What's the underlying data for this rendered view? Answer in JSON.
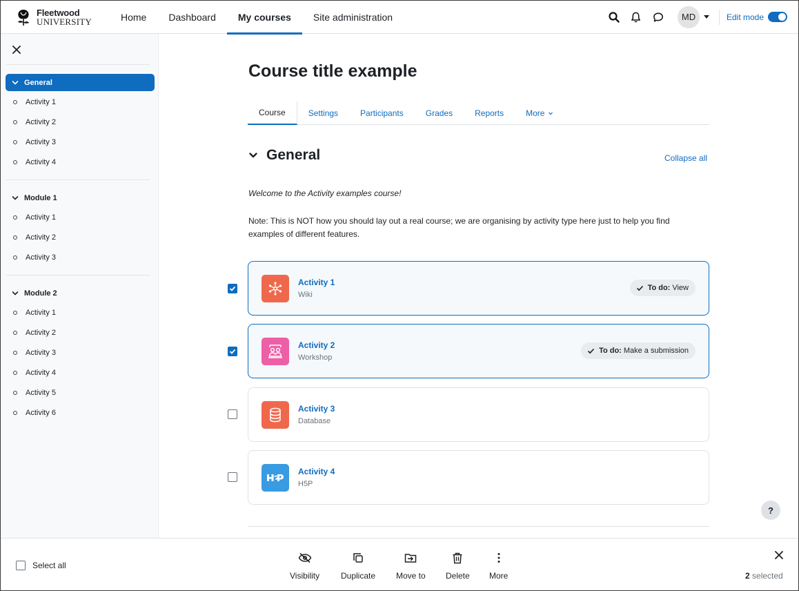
{
  "brand": {
    "line1": "Fleetwood",
    "line2": "UNIVERSITY"
  },
  "nav": {
    "items": [
      "Home",
      "Dashboard",
      "My courses",
      "Site administration"
    ],
    "active": "My courses"
  },
  "user": {
    "initials": "MD"
  },
  "edit_mode": {
    "label": "Edit mode",
    "on": true
  },
  "drawer": {
    "sections": [
      {
        "title": "General",
        "active": true,
        "items": [
          "Activity 1",
          "Activity 2",
          "Activity 3",
          "Activity 4"
        ]
      },
      {
        "title": "Module 1",
        "active": false,
        "items": [
          "Activity 1",
          "Activity 2",
          "Activity 3"
        ]
      },
      {
        "title": "Module 2",
        "active": false,
        "items": [
          "Activity 1",
          "Activity 2",
          "Activity 3",
          "Activity 4",
          "Activity 5",
          "Activity 6"
        ]
      }
    ]
  },
  "course": {
    "title": "Course title example",
    "tabs": [
      "Course",
      "Settings",
      "Participants",
      "Grades",
      "Reports",
      "More"
    ],
    "section_title": "General",
    "collapse_all": "Collapse all",
    "intro": "Welcome to the Activity examples course!",
    "note": "Note: This is NOT how you should lay out a real course; we are organising by activity type here just to help you find examples of different features."
  },
  "activities": [
    {
      "name": "Activity 1",
      "type": "Wiki",
      "icon": "wiki-icon",
      "color": "#f0684c",
      "checked": true,
      "todo_label": "To do:",
      "todo_text": "View"
    },
    {
      "name": "Activity 2",
      "type": "Workshop",
      "icon": "workshop-icon",
      "color": "#ed5fa6",
      "checked": true,
      "todo_label": "To do:",
      "todo_text": "Make a submission"
    },
    {
      "name": "Activity 3",
      "type": "Database",
      "icon": "database-icon",
      "color": "#f0684c",
      "checked": false
    },
    {
      "name": "Activity 4",
      "type": "H5P",
      "icon": "h5p-icon",
      "color": "#399be2",
      "checked": false
    }
  ],
  "help": "?",
  "bulk": {
    "select_all": "Select all",
    "actions": [
      "Visibility",
      "Duplicate",
      "Move to",
      "Delete",
      "More"
    ],
    "selected_count": "2",
    "selected_suffix": "selected"
  },
  "colors": {
    "primary": "#0f6cbf",
    "drawer_bg": "#f8f9fa"
  }
}
